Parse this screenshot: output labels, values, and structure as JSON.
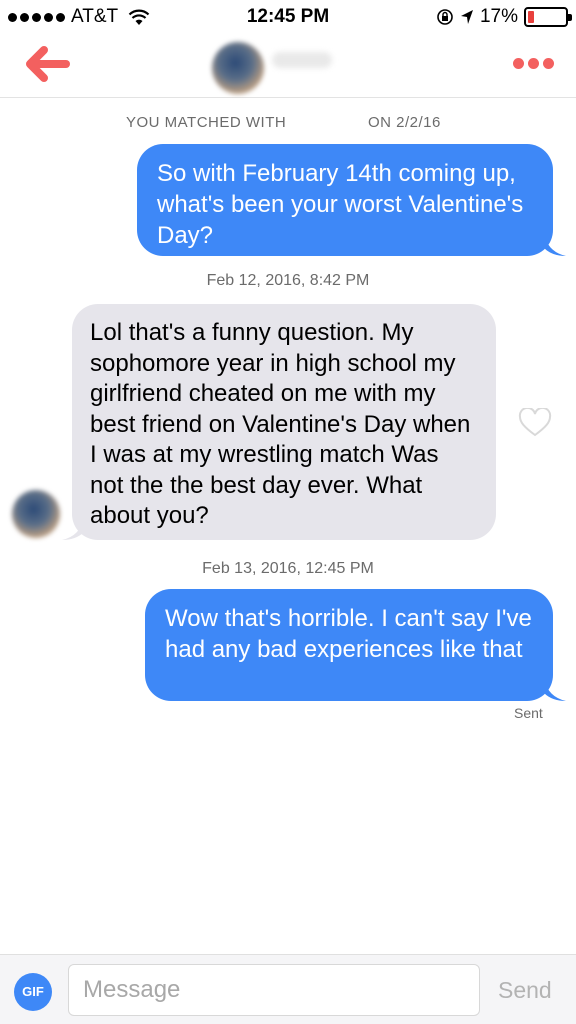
{
  "status_bar": {
    "carrier": "AT&T",
    "time": "12:45 PM",
    "battery_text": "17%",
    "battery_level": 0.17
  },
  "nav": {
    "back_icon": "back-arrow-icon",
    "more_icon": "more-dots-icon"
  },
  "chat": {
    "matched_label": "YOU MATCHED WITH",
    "matched_date": "ON 2/2/16",
    "messages": [
      {
        "direction": "outgoing",
        "text": "So with February 14th coming up, what's been your worst Valentine's Day?"
      },
      {
        "direction": "incoming",
        "timestamp": "Feb 12, 2016, 8:42 PM",
        "text": "Lol that's a funny question. My sophomore year in high school my girlfriend cheated on me with my best friend on Valentine's Day when I was at my wrestling match Was not the the best day ever. What about you?"
      },
      {
        "direction": "outgoing",
        "timestamp": "Feb 13, 2016, 12:45 PM",
        "text": "Wow that's horrible. I can't say I've had any bad experiences like that",
        "status": "Sent"
      }
    ]
  },
  "composer": {
    "gif_label": "GIF",
    "placeholder": "Message",
    "value": "",
    "send_label": "Send"
  },
  "colors": {
    "accent": "#3e88f7",
    "brand_red": "#f3605f",
    "incoming_bubble": "#e6e5eb"
  }
}
